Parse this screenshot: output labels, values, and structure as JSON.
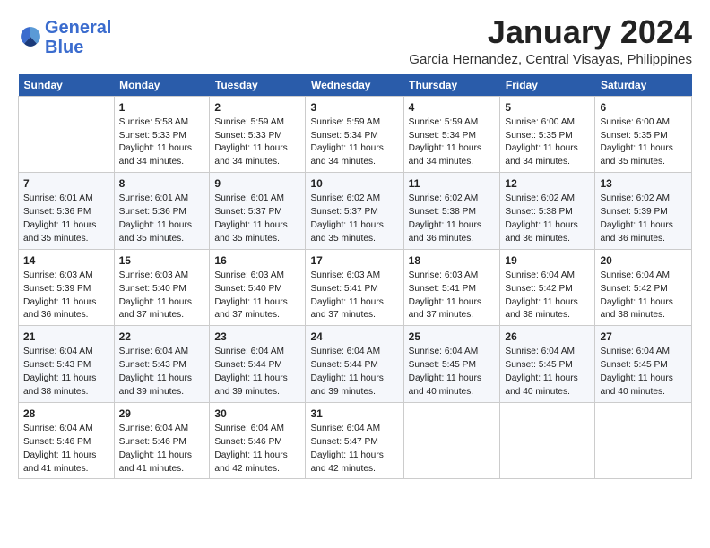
{
  "logo": {
    "line1": "General",
    "line2": "Blue"
  },
  "title": "January 2024",
  "location": "Garcia Hernandez, Central Visayas, Philippines",
  "days_of_week": [
    "Sunday",
    "Monday",
    "Tuesday",
    "Wednesday",
    "Thursday",
    "Friday",
    "Saturday"
  ],
  "weeks": [
    [
      {
        "day": "",
        "info": ""
      },
      {
        "day": "1",
        "info": "Sunrise: 5:58 AM\nSunset: 5:33 PM\nDaylight: 11 hours\nand 34 minutes."
      },
      {
        "day": "2",
        "info": "Sunrise: 5:59 AM\nSunset: 5:33 PM\nDaylight: 11 hours\nand 34 minutes."
      },
      {
        "day": "3",
        "info": "Sunrise: 5:59 AM\nSunset: 5:34 PM\nDaylight: 11 hours\nand 34 minutes."
      },
      {
        "day": "4",
        "info": "Sunrise: 5:59 AM\nSunset: 5:34 PM\nDaylight: 11 hours\nand 34 minutes."
      },
      {
        "day": "5",
        "info": "Sunrise: 6:00 AM\nSunset: 5:35 PM\nDaylight: 11 hours\nand 34 minutes."
      },
      {
        "day": "6",
        "info": "Sunrise: 6:00 AM\nSunset: 5:35 PM\nDaylight: 11 hours\nand 35 minutes."
      }
    ],
    [
      {
        "day": "7",
        "info": "Sunrise: 6:01 AM\nSunset: 5:36 PM\nDaylight: 11 hours\nand 35 minutes."
      },
      {
        "day": "8",
        "info": "Sunrise: 6:01 AM\nSunset: 5:36 PM\nDaylight: 11 hours\nand 35 minutes."
      },
      {
        "day": "9",
        "info": "Sunrise: 6:01 AM\nSunset: 5:37 PM\nDaylight: 11 hours\nand 35 minutes."
      },
      {
        "day": "10",
        "info": "Sunrise: 6:02 AM\nSunset: 5:37 PM\nDaylight: 11 hours\nand 35 minutes."
      },
      {
        "day": "11",
        "info": "Sunrise: 6:02 AM\nSunset: 5:38 PM\nDaylight: 11 hours\nand 36 minutes."
      },
      {
        "day": "12",
        "info": "Sunrise: 6:02 AM\nSunset: 5:38 PM\nDaylight: 11 hours\nand 36 minutes."
      },
      {
        "day": "13",
        "info": "Sunrise: 6:02 AM\nSunset: 5:39 PM\nDaylight: 11 hours\nand 36 minutes."
      }
    ],
    [
      {
        "day": "14",
        "info": "Sunrise: 6:03 AM\nSunset: 5:39 PM\nDaylight: 11 hours\nand 36 minutes."
      },
      {
        "day": "15",
        "info": "Sunrise: 6:03 AM\nSunset: 5:40 PM\nDaylight: 11 hours\nand 37 minutes."
      },
      {
        "day": "16",
        "info": "Sunrise: 6:03 AM\nSunset: 5:40 PM\nDaylight: 11 hours\nand 37 minutes."
      },
      {
        "day": "17",
        "info": "Sunrise: 6:03 AM\nSunset: 5:41 PM\nDaylight: 11 hours\nand 37 minutes."
      },
      {
        "day": "18",
        "info": "Sunrise: 6:03 AM\nSunset: 5:41 PM\nDaylight: 11 hours\nand 37 minutes."
      },
      {
        "day": "19",
        "info": "Sunrise: 6:04 AM\nSunset: 5:42 PM\nDaylight: 11 hours\nand 38 minutes."
      },
      {
        "day": "20",
        "info": "Sunrise: 6:04 AM\nSunset: 5:42 PM\nDaylight: 11 hours\nand 38 minutes."
      }
    ],
    [
      {
        "day": "21",
        "info": "Sunrise: 6:04 AM\nSunset: 5:43 PM\nDaylight: 11 hours\nand 38 minutes."
      },
      {
        "day": "22",
        "info": "Sunrise: 6:04 AM\nSunset: 5:43 PM\nDaylight: 11 hours\nand 39 minutes."
      },
      {
        "day": "23",
        "info": "Sunrise: 6:04 AM\nSunset: 5:44 PM\nDaylight: 11 hours\nand 39 minutes."
      },
      {
        "day": "24",
        "info": "Sunrise: 6:04 AM\nSunset: 5:44 PM\nDaylight: 11 hours\nand 39 minutes."
      },
      {
        "day": "25",
        "info": "Sunrise: 6:04 AM\nSunset: 5:45 PM\nDaylight: 11 hours\nand 40 minutes."
      },
      {
        "day": "26",
        "info": "Sunrise: 6:04 AM\nSunset: 5:45 PM\nDaylight: 11 hours\nand 40 minutes."
      },
      {
        "day": "27",
        "info": "Sunrise: 6:04 AM\nSunset: 5:45 PM\nDaylight: 11 hours\nand 40 minutes."
      }
    ],
    [
      {
        "day": "28",
        "info": "Sunrise: 6:04 AM\nSunset: 5:46 PM\nDaylight: 11 hours\nand 41 minutes."
      },
      {
        "day": "29",
        "info": "Sunrise: 6:04 AM\nSunset: 5:46 PM\nDaylight: 11 hours\nand 41 minutes."
      },
      {
        "day": "30",
        "info": "Sunrise: 6:04 AM\nSunset: 5:46 PM\nDaylight: 11 hours\nand 42 minutes."
      },
      {
        "day": "31",
        "info": "Sunrise: 6:04 AM\nSunset: 5:47 PM\nDaylight: 11 hours\nand 42 minutes."
      },
      {
        "day": "",
        "info": ""
      },
      {
        "day": "",
        "info": ""
      },
      {
        "day": "",
        "info": ""
      }
    ]
  ]
}
